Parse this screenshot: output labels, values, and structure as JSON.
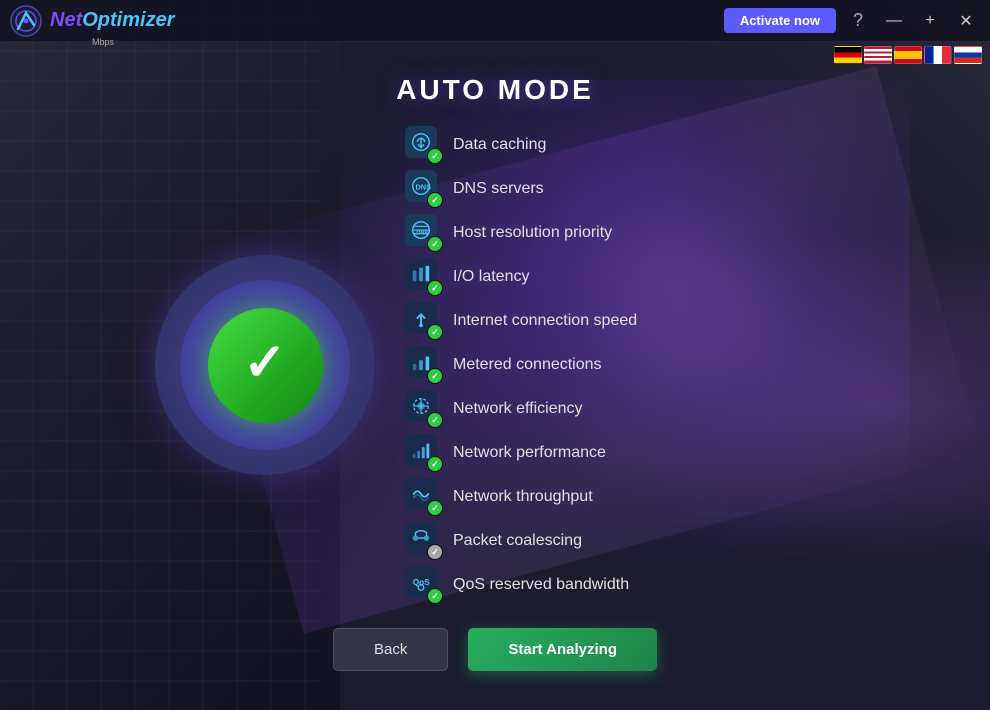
{
  "app": {
    "title": "NetOptimizer",
    "logo_text_net": "Net",
    "logo_text_opt": "Optimizer",
    "mbps_label": "Mbps"
  },
  "titlebar": {
    "activate_label": "Activate now",
    "help_label": "?",
    "minimize_label": "—",
    "maximize_label": "+",
    "close_label": "✕"
  },
  "page": {
    "title": "AUTO MODE"
  },
  "features": [
    {
      "id": "data-caching",
      "label": "Data caching",
      "icon": "🔄",
      "checked": true
    },
    {
      "id": "dns-servers",
      "label": "DNS servers",
      "icon": "🌐",
      "checked": true
    },
    {
      "id": "host-resolution",
      "label": "Host resolution priority",
      "icon": "🌍",
      "checked": true
    },
    {
      "id": "io-latency",
      "label": "I/O latency",
      "icon": "📶",
      "checked": true
    },
    {
      "id": "internet-speed",
      "label": "Internet connection speed",
      "icon": "⚡",
      "checked": true
    },
    {
      "id": "metered-connections",
      "label": "Metered connections",
      "icon": "📊",
      "checked": true
    },
    {
      "id": "network-efficiency",
      "label": "Network efficiency",
      "icon": "⚙️",
      "checked": true
    },
    {
      "id": "network-performance",
      "label": "Network performance",
      "icon": "📈",
      "checked": true
    },
    {
      "id": "network-throughput",
      "label": "Network throughput",
      "icon": "📡",
      "checked": true
    },
    {
      "id": "packet-coalescing",
      "label": "Packet coalescing",
      "icon": "🔗",
      "checked": false
    },
    {
      "id": "qos-bandwidth",
      "label": "QoS reserved bandwidth",
      "icon": "🎯",
      "checked": true
    }
  ],
  "buttons": {
    "back_label": "Back",
    "start_label": "Start Analyzing"
  },
  "flags": [
    {
      "id": "de",
      "name": "German",
      "class": "flag-de"
    },
    {
      "id": "us",
      "name": "English",
      "class": "flag-us"
    },
    {
      "id": "es",
      "name": "Spanish",
      "class": "flag-es"
    },
    {
      "id": "fr",
      "name": "French",
      "class": "flag-fr"
    },
    {
      "id": "ru",
      "name": "Russian",
      "class": "flag-ru"
    }
  ]
}
